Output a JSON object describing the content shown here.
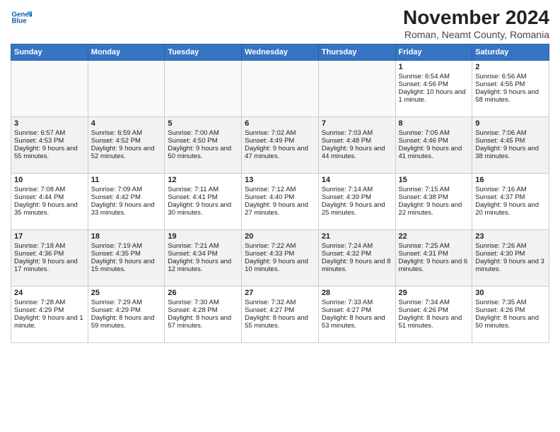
{
  "header": {
    "logo_line1": "General",
    "logo_line2": "Blue",
    "title": "November 2024",
    "subtitle": "Roman, Neamt County, Romania"
  },
  "weekdays": [
    "Sunday",
    "Monday",
    "Tuesday",
    "Wednesday",
    "Thursday",
    "Friday",
    "Saturday"
  ],
  "weeks": [
    [
      {
        "day": "",
        "info": ""
      },
      {
        "day": "",
        "info": ""
      },
      {
        "day": "",
        "info": ""
      },
      {
        "day": "",
        "info": ""
      },
      {
        "day": "",
        "info": ""
      },
      {
        "day": "1",
        "info": "Sunrise: 6:54 AM\nSunset: 4:56 PM\nDaylight: 10 hours and 1 minute."
      },
      {
        "day": "2",
        "info": "Sunrise: 6:56 AM\nSunset: 4:55 PM\nDaylight: 9 hours and 58 minutes."
      }
    ],
    [
      {
        "day": "3",
        "info": "Sunrise: 6:57 AM\nSunset: 4:53 PM\nDaylight: 9 hours and 55 minutes."
      },
      {
        "day": "4",
        "info": "Sunrise: 6:59 AM\nSunset: 4:52 PM\nDaylight: 9 hours and 52 minutes."
      },
      {
        "day": "5",
        "info": "Sunrise: 7:00 AM\nSunset: 4:50 PM\nDaylight: 9 hours and 50 minutes."
      },
      {
        "day": "6",
        "info": "Sunrise: 7:02 AM\nSunset: 4:49 PM\nDaylight: 9 hours and 47 minutes."
      },
      {
        "day": "7",
        "info": "Sunrise: 7:03 AM\nSunset: 4:48 PM\nDaylight: 9 hours and 44 minutes."
      },
      {
        "day": "8",
        "info": "Sunrise: 7:05 AM\nSunset: 4:46 PM\nDaylight: 9 hours and 41 minutes."
      },
      {
        "day": "9",
        "info": "Sunrise: 7:06 AM\nSunset: 4:45 PM\nDaylight: 9 hours and 38 minutes."
      }
    ],
    [
      {
        "day": "10",
        "info": "Sunrise: 7:08 AM\nSunset: 4:44 PM\nDaylight: 9 hours and 35 minutes."
      },
      {
        "day": "11",
        "info": "Sunrise: 7:09 AM\nSunset: 4:42 PM\nDaylight: 9 hours and 33 minutes."
      },
      {
        "day": "12",
        "info": "Sunrise: 7:11 AM\nSunset: 4:41 PM\nDaylight: 9 hours and 30 minutes."
      },
      {
        "day": "13",
        "info": "Sunrise: 7:12 AM\nSunset: 4:40 PM\nDaylight: 9 hours and 27 minutes."
      },
      {
        "day": "14",
        "info": "Sunrise: 7:14 AM\nSunset: 4:39 PM\nDaylight: 9 hours and 25 minutes."
      },
      {
        "day": "15",
        "info": "Sunrise: 7:15 AM\nSunset: 4:38 PM\nDaylight: 9 hours and 22 minutes."
      },
      {
        "day": "16",
        "info": "Sunrise: 7:16 AM\nSunset: 4:37 PM\nDaylight: 9 hours and 20 minutes."
      }
    ],
    [
      {
        "day": "17",
        "info": "Sunrise: 7:18 AM\nSunset: 4:36 PM\nDaylight: 9 hours and 17 minutes."
      },
      {
        "day": "18",
        "info": "Sunrise: 7:19 AM\nSunset: 4:35 PM\nDaylight: 9 hours and 15 minutes."
      },
      {
        "day": "19",
        "info": "Sunrise: 7:21 AM\nSunset: 4:34 PM\nDaylight: 9 hours and 12 minutes."
      },
      {
        "day": "20",
        "info": "Sunrise: 7:22 AM\nSunset: 4:33 PM\nDaylight: 9 hours and 10 minutes."
      },
      {
        "day": "21",
        "info": "Sunrise: 7:24 AM\nSunset: 4:32 PM\nDaylight: 9 hours and 8 minutes."
      },
      {
        "day": "22",
        "info": "Sunrise: 7:25 AM\nSunset: 4:31 PM\nDaylight: 9 hours and 6 minutes."
      },
      {
        "day": "23",
        "info": "Sunrise: 7:26 AM\nSunset: 4:30 PM\nDaylight: 9 hours and 3 minutes."
      }
    ],
    [
      {
        "day": "24",
        "info": "Sunrise: 7:28 AM\nSunset: 4:29 PM\nDaylight: 9 hours and 1 minute."
      },
      {
        "day": "25",
        "info": "Sunrise: 7:29 AM\nSunset: 4:29 PM\nDaylight: 8 hours and 59 minutes."
      },
      {
        "day": "26",
        "info": "Sunrise: 7:30 AM\nSunset: 4:28 PM\nDaylight: 8 hours and 57 minutes."
      },
      {
        "day": "27",
        "info": "Sunrise: 7:32 AM\nSunset: 4:27 PM\nDaylight: 8 hours and 55 minutes."
      },
      {
        "day": "28",
        "info": "Sunrise: 7:33 AM\nSunset: 4:27 PM\nDaylight: 8 hours and 53 minutes."
      },
      {
        "day": "29",
        "info": "Sunrise: 7:34 AM\nSunset: 4:26 PM\nDaylight: 8 hours and 51 minutes."
      },
      {
        "day": "30",
        "info": "Sunrise: 7:35 AM\nSunset: 4:26 PM\nDaylight: 8 hours and 50 minutes."
      }
    ]
  ]
}
